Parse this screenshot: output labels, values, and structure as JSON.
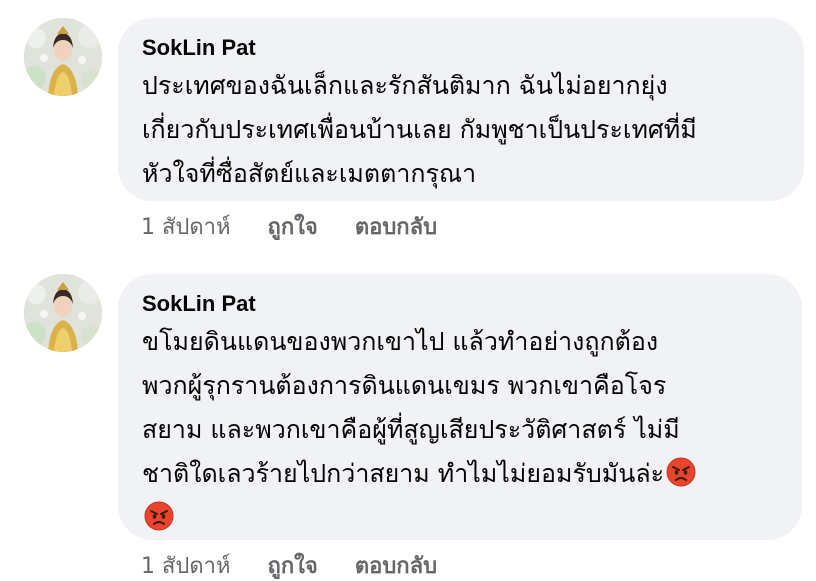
{
  "comments": [
    {
      "author": "SokLin Pat",
      "lines": [
        "ประเทศของฉันเล็กและรักสันติมาก ฉันไม่อยากยุ่ง",
        "เกี่ยวกับประเทศเพื่อนบ้านเลย กัมพูชาเป็นประเทศที่มี",
        "หัวใจที่ซื่อสัตย์และเมตตากรุณา"
      ],
      "time": "1 สัปดาห์",
      "like_label": "ถูกใจ",
      "reply_label": "ตอบกลับ"
    },
    {
      "author": "SokLin Pat",
      "lines": [
        "ขโมยดินแดนของพวกเขาไป แล้วทำอย่างถูกต้อง",
        "พวกผู้รุกรานต้องการดินแดนเขมร พวกเขาคือโจร",
        "สยาม และพวกเขาคือผู้ที่สูญเสียประวัติศาสตร์ ไม่มี",
        "ชาติใดเลวร้ายไปกว่าสยาม ทำไมไม่ยอมรับมันล่ะ"
      ],
      "emojis": [
        "angry-face",
        "angry-face"
      ],
      "time": "1 สัปดาห์",
      "like_label": "ถูกใจ",
      "reply_label": "ตอบกลับ"
    }
  ],
  "colors": {
    "bubble": "#f0f2f5",
    "text": "#050505",
    "meta": "#65676b",
    "emoji_face": "#e8452c"
  }
}
